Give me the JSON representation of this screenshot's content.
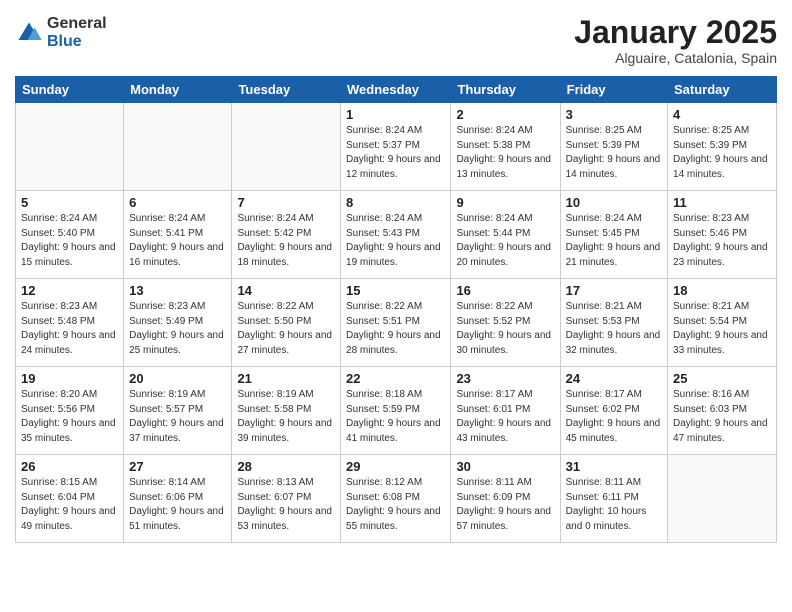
{
  "logo": {
    "general": "General",
    "blue": "Blue"
  },
  "header": {
    "month": "January 2025",
    "location": "Alguaire, Catalonia, Spain"
  },
  "weekdays": [
    "Sunday",
    "Monday",
    "Tuesday",
    "Wednesday",
    "Thursday",
    "Friday",
    "Saturday"
  ],
  "weeks": [
    [
      {
        "day": "",
        "info": ""
      },
      {
        "day": "",
        "info": ""
      },
      {
        "day": "",
        "info": ""
      },
      {
        "day": "1",
        "info": "Sunrise: 8:24 AM\nSunset: 5:37 PM\nDaylight: 9 hours and 12 minutes."
      },
      {
        "day": "2",
        "info": "Sunrise: 8:24 AM\nSunset: 5:38 PM\nDaylight: 9 hours and 13 minutes."
      },
      {
        "day": "3",
        "info": "Sunrise: 8:25 AM\nSunset: 5:39 PM\nDaylight: 9 hours and 14 minutes."
      },
      {
        "day": "4",
        "info": "Sunrise: 8:25 AM\nSunset: 5:39 PM\nDaylight: 9 hours and 14 minutes."
      }
    ],
    [
      {
        "day": "5",
        "info": "Sunrise: 8:24 AM\nSunset: 5:40 PM\nDaylight: 9 hours and 15 minutes."
      },
      {
        "day": "6",
        "info": "Sunrise: 8:24 AM\nSunset: 5:41 PM\nDaylight: 9 hours and 16 minutes."
      },
      {
        "day": "7",
        "info": "Sunrise: 8:24 AM\nSunset: 5:42 PM\nDaylight: 9 hours and 18 minutes."
      },
      {
        "day": "8",
        "info": "Sunrise: 8:24 AM\nSunset: 5:43 PM\nDaylight: 9 hours and 19 minutes."
      },
      {
        "day": "9",
        "info": "Sunrise: 8:24 AM\nSunset: 5:44 PM\nDaylight: 9 hours and 20 minutes."
      },
      {
        "day": "10",
        "info": "Sunrise: 8:24 AM\nSunset: 5:45 PM\nDaylight: 9 hours and 21 minutes."
      },
      {
        "day": "11",
        "info": "Sunrise: 8:23 AM\nSunset: 5:46 PM\nDaylight: 9 hours and 23 minutes."
      }
    ],
    [
      {
        "day": "12",
        "info": "Sunrise: 8:23 AM\nSunset: 5:48 PM\nDaylight: 9 hours and 24 minutes."
      },
      {
        "day": "13",
        "info": "Sunrise: 8:23 AM\nSunset: 5:49 PM\nDaylight: 9 hours and 25 minutes."
      },
      {
        "day": "14",
        "info": "Sunrise: 8:22 AM\nSunset: 5:50 PM\nDaylight: 9 hours and 27 minutes."
      },
      {
        "day": "15",
        "info": "Sunrise: 8:22 AM\nSunset: 5:51 PM\nDaylight: 9 hours and 28 minutes."
      },
      {
        "day": "16",
        "info": "Sunrise: 8:22 AM\nSunset: 5:52 PM\nDaylight: 9 hours and 30 minutes."
      },
      {
        "day": "17",
        "info": "Sunrise: 8:21 AM\nSunset: 5:53 PM\nDaylight: 9 hours and 32 minutes."
      },
      {
        "day": "18",
        "info": "Sunrise: 8:21 AM\nSunset: 5:54 PM\nDaylight: 9 hours and 33 minutes."
      }
    ],
    [
      {
        "day": "19",
        "info": "Sunrise: 8:20 AM\nSunset: 5:56 PM\nDaylight: 9 hours and 35 minutes."
      },
      {
        "day": "20",
        "info": "Sunrise: 8:19 AM\nSunset: 5:57 PM\nDaylight: 9 hours and 37 minutes."
      },
      {
        "day": "21",
        "info": "Sunrise: 8:19 AM\nSunset: 5:58 PM\nDaylight: 9 hours and 39 minutes."
      },
      {
        "day": "22",
        "info": "Sunrise: 8:18 AM\nSunset: 5:59 PM\nDaylight: 9 hours and 41 minutes."
      },
      {
        "day": "23",
        "info": "Sunrise: 8:17 AM\nSunset: 6:01 PM\nDaylight: 9 hours and 43 minutes."
      },
      {
        "day": "24",
        "info": "Sunrise: 8:17 AM\nSunset: 6:02 PM\nDaylight: 9 hours and 45 minutes."
      },
      {
        "day": "25",
        "info": "Sunrise: 8:16 AM\nSunset: 6:03 PM\nDaylight: 9 hours and 47 minutes."
      }
    ],
    [
      {
        "day": "26",
        "info": "Sunrise: 8:15 AM\nSunset: 6:04 PM\nDaylight: 9 hours and 49 minutes."
      },
      {
        "day": "27",
        "info": "Sunrise: 8:14 AM\nSunset: 6:06 PM\nDaylight: 9 hours and 51 minutes."
      },
      {
        "day": "28",
        "info": "Sunrise: 8:13 AM\nSunset: 6:07 PM\nDaylight: 9 hours and 53 minutes."
      },
      {
        "day": "29",
        "info": "Sunrise: 8:12 AM\nSunset: 6:08 PM\nDaylight: 9 hours and 55 minutes."
      },
      {
        "day": "30",
        "info": "Sunrise: 8:11 AM\nSunset: 6:09 PM\nDaylight: 9 hours and 57 minutes."
      },
      {
        "day": "31",
        "info": "Sunrise: 8:11 AM\nSunset: 6:11 PM\nDaylight: 10 hours and 0 minutes."
      },
      {
        "day": "",
        "info": ""
      }
    ]
  ]
}
